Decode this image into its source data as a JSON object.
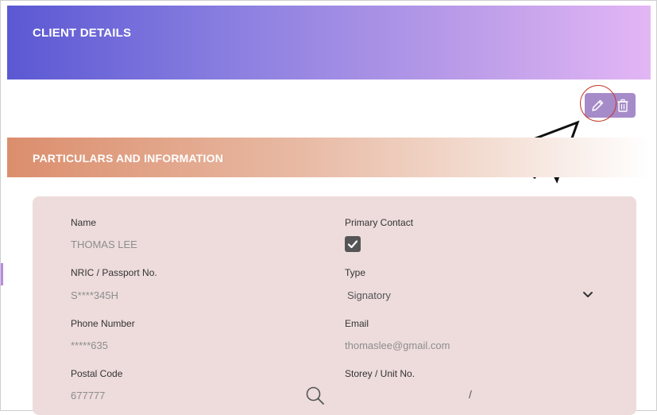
{
  "header": {
    "title": "CLIENT DETAILS"
  },
  "toolbar": {
    "edit_icon": "pencil-icon",
    "delete_icon": "trash-icon"
  },
  "section": {
    "title": "PARTICULARS AND INFORMATION"
  },
  "fields": {
    "name": {
      "label": "Name",
      "value": "THOMAS LEE"
    },
    "primary_contact": {
      "label": "Primary Contact",
      "checked": true
    },
    "nric": {
      "label": "NRIC / Passport No.",
      "value": "S****345H"
    },
    "type": {
      "label": "Type",
      "value": "Signatory"
    },
    "phone": {
      "label": "Phone Number",
      "value": "*****635"
    },
    "email": {
      "label": "Email",
      "value": "thomaslee@gmail.com"
    },
    "postal": {
      "label": "Postal Code",
      "value": "677777"
    },
    "storey": {
      "label": "Storey / Unit No.",
      "separator": "/"
    }
  },
  "colors": {
    "header_gradient": [
      "#5b58d3",
      "#e3b6f5"
    ],
    "section_gradient": [
      "#db8e6d",
      "#ffffff"
    ],
    "card_bg": "#eedcdc",
    "action_button": "#a68bc9",
    "highlight_ring": "#c23a2a"
  }
}
